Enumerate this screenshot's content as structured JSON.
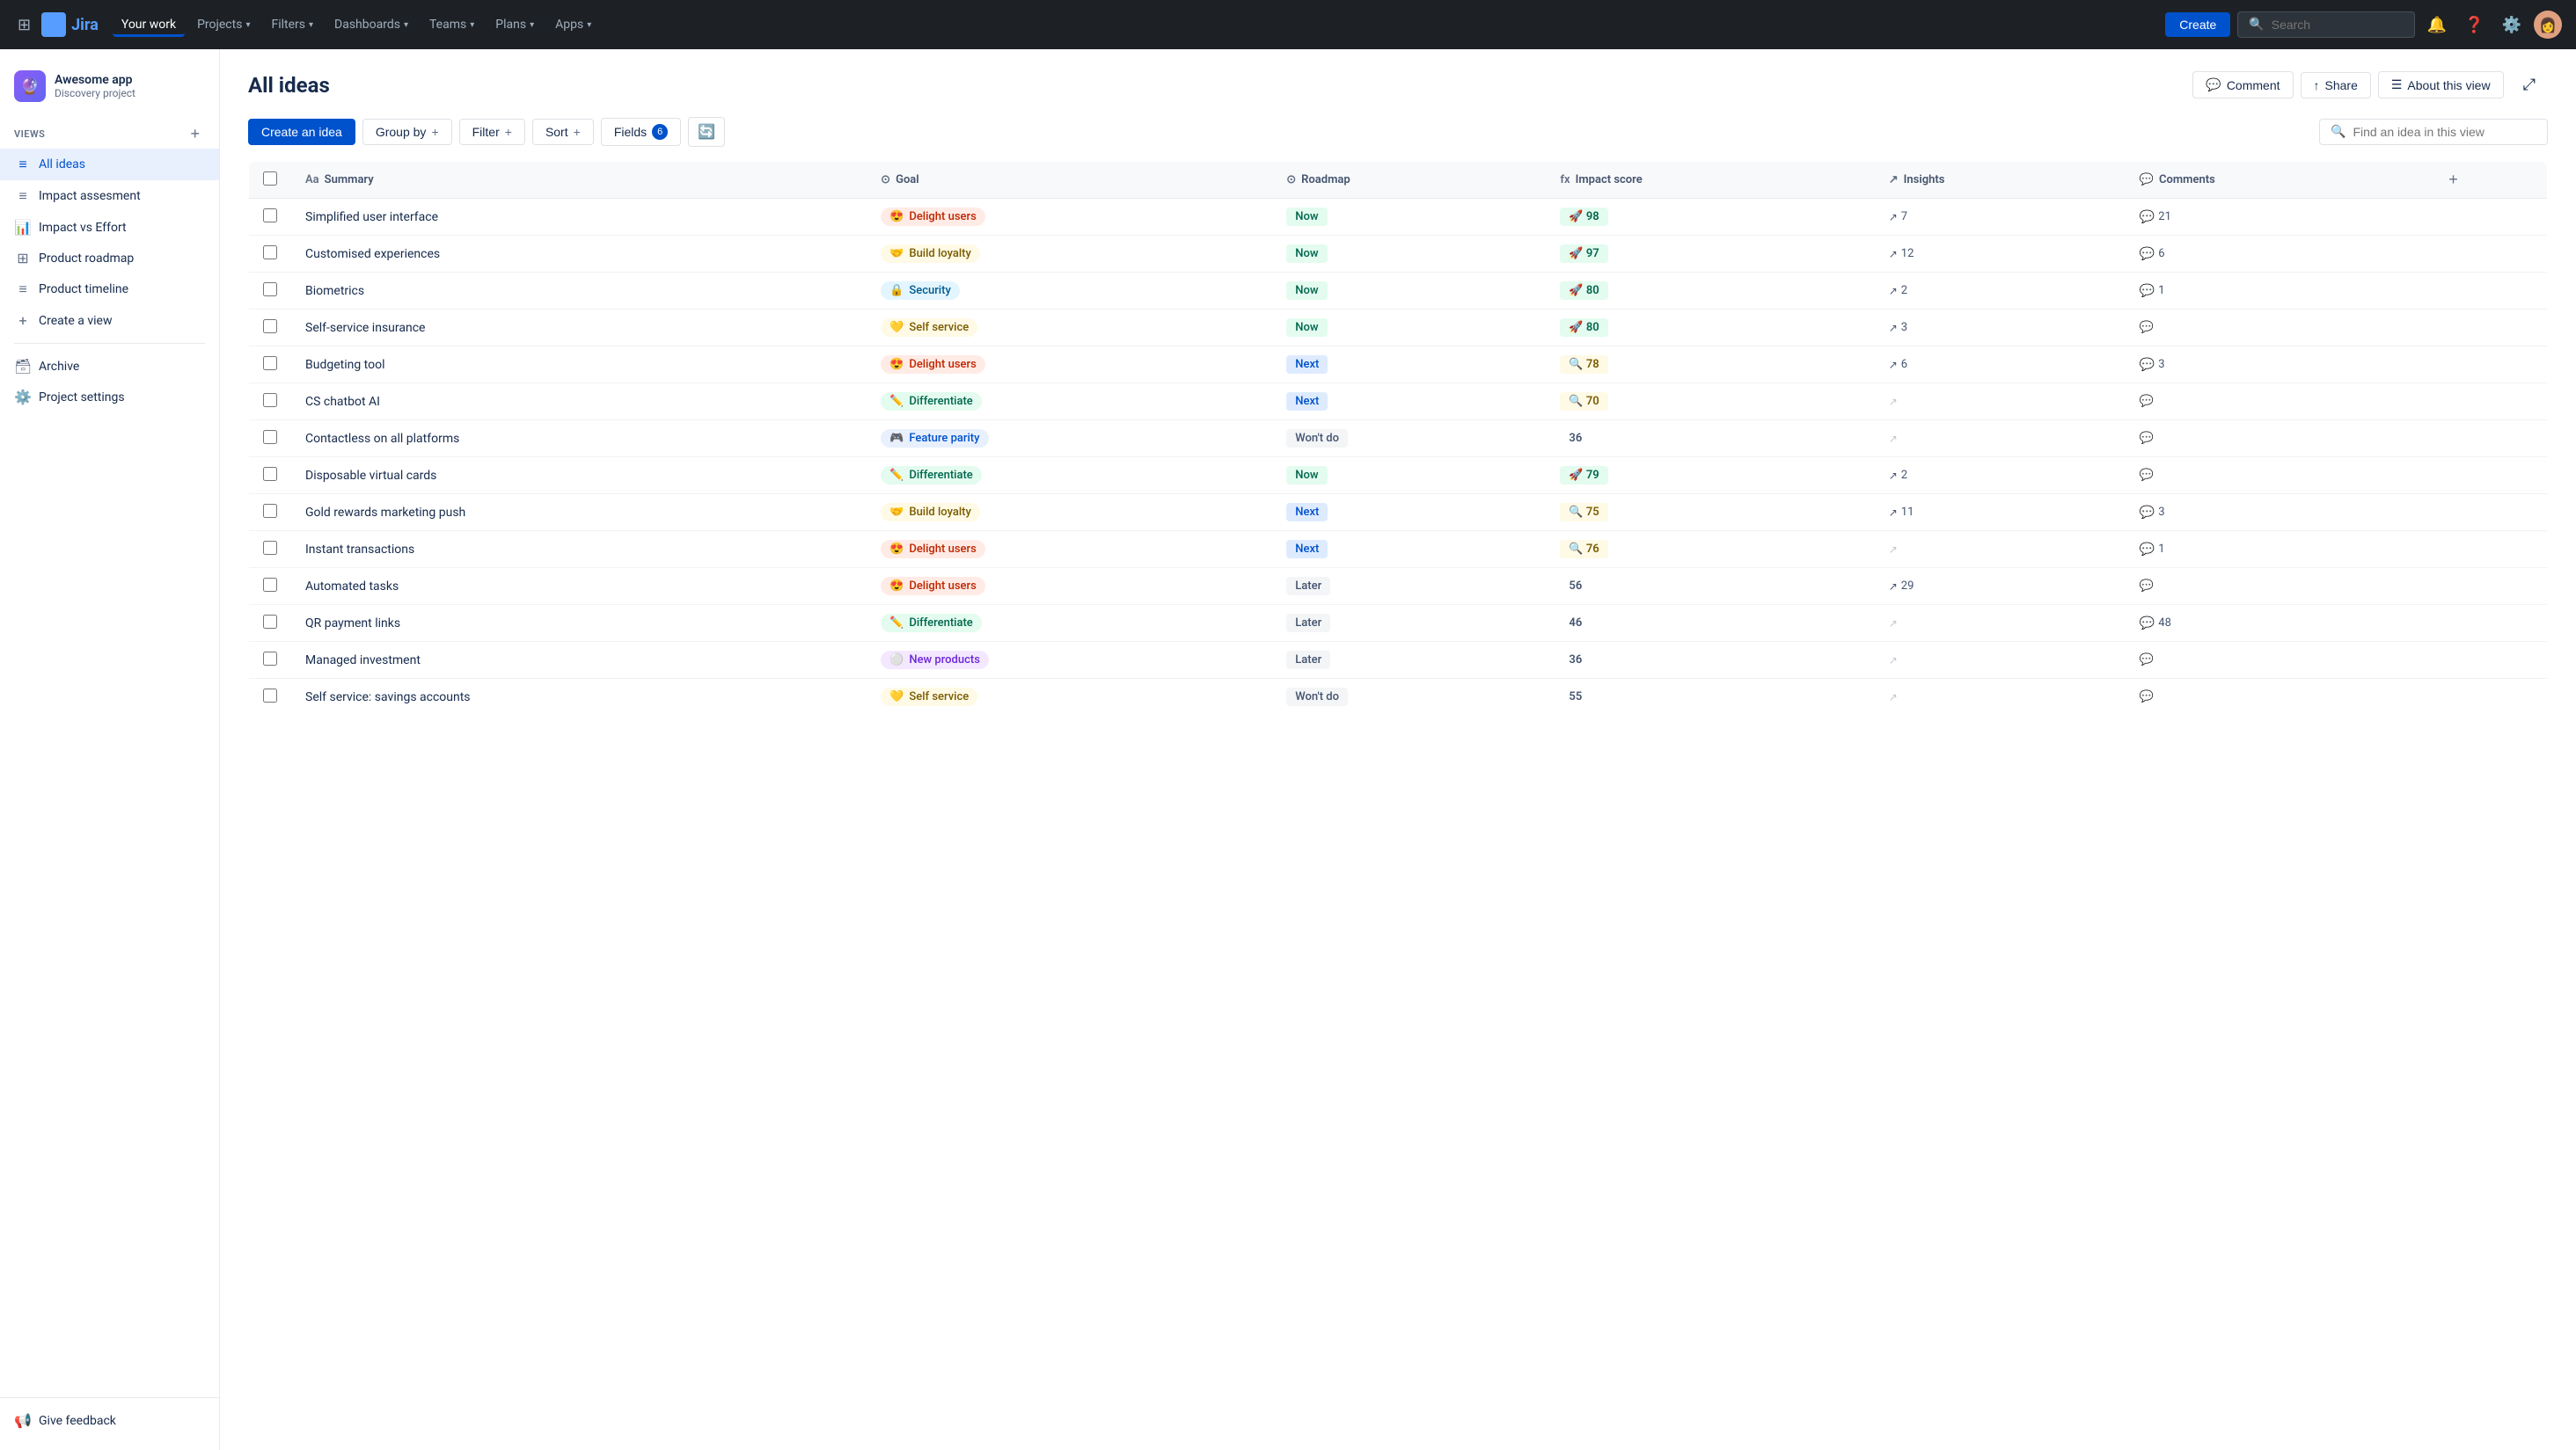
{
  "nav": {
    "logo_text": "Jira",
    "items": [
      {
        "label": "Your work",
        "id": "your-work",
        "active": true
      },
      {
        "label": "Projects",
        "id": "projects"
      },
      {
        "label": "Filters",
        "id": "filters"
      },
      {
        "label": "Dashboards",
        "id": "dashboards"
      },
      {
        "label": "Teams",
        "id": "teams"
      },
      {
        "label": "Plans",
        "id": "plans"
      },
      {
        "label": "Apps",
        "id": "apps"
      }
    ],
    "create_label": "Create",
    "search_placeholder": "Search"
  },
  "sidebar": {
    "project_icon": "🔮",
    "project_name": "Awesome app",
    "project_type": "Discovery project",
    "views_label": "VIEWS",
    "views": [
      {
        "label": "All ideas",
        "id": "all-ideas",
        "icon": "≡",
        "active": true
      },
      {
        "label": "Impact assesment",
        "id": "impact-assesment",
        "icon": "≡"
      },
      {
        "label": "Impact vs Effort",
        "id": "impact-vs-effort",
        "icon": "📊"
      },
      {
        "label": "Product roadmap",
        "id": "product-roadmap",
        "icon": "⊞"
      },
      {
        "label": "Product timeline",
        "id": "product-timeline",
        "icon": "≡"
      },
      {
        "label": "Create a view",
        "id": "create-a-view",
        "icon": "+"
      }
    ],
    "archive_label": "Archive",
    "project_settings_label": "Project settings",
    "feedback_label": "Give feedback"
  },
  "page": {
    "title": "All ideas",
    "comment_btn": "Comment",
    "share_btn": "Share",
    "about_btn": "About this view"
  },
  "toolbar": {
    "create_idea_label": "Create an idea",
    "group_by_label": "Group by",
    "filter_label": "Filter",
    "sort_label": "Sort",
    "fields_label": "Fields",
    "fields_count": "6",
    "search_placeholder": "Find an idea in this view"
  },
  "table": {
    "columns": [
      {
        "label": "Summary",
        "icon": "Aa",
        "id": "summary"
      },
      {
        "label": "Goal",
        "icon": "⊙",
        "id": "goal"
      },
      {
        "label": "Roadmap",
        "icon": "⊙",
        "id": "roadmap"
      },
      {
        "label": "Impact score",
        "icon": "fx",
        "id": "impact"
      },
      {
        "label": "Insights",
        "icon": "↗",
        "id": "insights"
      },
      {
        "label": "Comments",
        "icon": "💬",
        "id": "comments"
      }
    ],
    "rows": [
      {
        "id": 1,
        "summary": "Simplified user interface",
        "goal_emoji": "😍",
        "goal_label": "Delight users",
        "goal_class": "goal-delight",
        "roadmap": "Now",
        "roadmap_class": "roadmap-now",
        "impact_emoji": "🚀",
        "impact_score": "98",
        "impact_class": "impact-high",
        "insights": "7",
        "has_insights": true,
        "comments": "21",
        "has_comments": true
      },
      {
        "id": 2,
        "summary": "Customised experiences",
        "goal_emoji": "🤝",
        "goal_label": "Build loyalty",
        "goal_class": "goal-build",
        "roadmap": "Now",
        "roadmap_class": "roadmap-now",
        "impact_emoji": "🚀",
        "impact_score": "97",
        "impact_class": "impact-high",
        "insights": "12",
        "has_insights": true,
        "comments": "6",
        "has_comments": true
      },
      {
        "id": 3,
        "summary": "Biometrics",
        "goal_emoji": "🔒",
        "goal_label": "Security",
        "goal_class": "goal-security",
        "roadmap": "Now",
        "roadmap_class": "roadmap-now",
        "impact_emoji": "🚀",
        "impact_score": "80",
        "impact_class": "impact-high",
        "insights": "2",
        "has_insights": true,
        "comments": "1",
        "has_comments": true
      },
      {
        "id": 4,
        "summary": "Self-service insurance",
        "goal_emoji": "💛",
        "goal_label": "Self service",
        "goal_class": "goal-self",
        "roadmap": "Now",
        "roadmap_class": "roadmap-now",
        "impact_emoji": "🚀",
        "impact_score": "80",
        "impact_class": "impact-high",
        "insights": "3",
        "has_insights": true,
        "comments": "",
        "has_comments": false
      },
      {
        "id": 5,
        "summary": "Budgeting tool",
        "goal_emoji": "😍",
        "goal_label": "Delight users",
        "goal_class": "goal-delight",
        "roadmap": "Next",
        "roadmap_class": "roadmap-next",
        "impact_emoji": "🔍",
        "impact_score": "78",
        "impact_class": "impact-medium",
        "insights": "6",
        "has_insights": true,
        "comments": "3",
        "has_comments": true
      },
      {
        "id": 6,
        "summary": "CS chatbot AI",
        "goal_emoji": "✏️",
        "goal_label": "Differentiate",
        "goal_class": "goal-differentiate",
        "roadmap": "Next",
        "roadmap_class": "roadmap-next",
        "impact_emoji": "🔍",
        "impact_score": "70",
        "impact_class": "impact-medium",
        "insights": "",
        "has_insights": false,
        "comments": "",
        "has_comments": false
      },
      {
        "id": 7,
        "summary": "Contactless on all platforms",
        "goal_emoji": "🎮",
        "goal_label": "Feature parity",
        "goal_class": "goal-feature",
        "roadmap": "Won't do",
        "roadmap_class": "roadmap-wontdo",
        "impact_emoji": "",
        "impact_score": "36",
        "impact_class": "impact-none",
        "insights": "",
        "has_insights": false,
        "comments": "",
        "has_comments": false
      },
      {
        "id": 8,
        "summary": "Disposable virtual cards",
        "goal_emoji": "✏️",
        "goal_label": "Differentiate",
        "goal_class": "goal-differentiate",
        "roadmap": "Now",
        "roadmap_class": "roadmap-now",
        "impact_emoji": "🚀",
        "impact_score": "79",
        "impact_class": "impact-high",
        "insights": "2",
        "has_insights": true,
        "comments": "",
        "has_comments": false
      },
      {
        "id": 9,
        "summary": "Gold rewards marketing push",
        "goal_emoji": "🤝",
        "goal_label": "Build loyalty",
        "goal_class": "goal-build",
        "roadmap": "Next",
        "roadmap_class": "roadmap-next",
        "impact_emoji": "🔍",
        "impact_score": "75",
        "impact_class": "impact-medium",
        "insights": "11",
        "has_insights": true,
        "comments": "3",
        "has_comments": true
      },
      {
        "id": 10,
        "summary": "Instant transactions",
        "goal_emoji": "😍",
        "goal_label": "Delight users",
        "goal_class": "goal-delight",
        "roadmap": "Next",
        "roadmap_class": "roadmap-next",
        "impact_emoji": "🔍",
        "impact_score": "76",
        "impact_class": "impact-medium",
        "insights": "",
        "has_insights": false,
        "comments": "1",
        "has_comments": true
      },
      {
        "id": 11,
        "summary": "Automated tasks",
        "goal_emoji": "😍",
        "goal_label": "Delight users",
        "goal_class": "goal-delight",
        "roadmap": "Later",
        "roadmap_class": "roadmap-later",
        "impact_emoji": "",
        "impact_score": "56",
        "impact_class": "impact-none",
        "insights": "29",
        "has_insights": true,
        "comments": "",
        "has_comments": false
      },
      {
        "id": 12,
        "summary": "QR payment links",
        "goal_emoji": "✏️",
        "goal_label": "Differentiate",
        "goal_class": "goal-differentiate",
        "roadmap": "Later",
        "roadmap_class": "roadmap-later",
        "impact_emoji": "",
        "impact_score": "46",
        "impact_class": "impact-none",
        "insights": "",
        "has_insights": false,
        "comments": "48",
        "has_comments": true
      },
      {
        "id": 13,
        "summary": "Managed investment",
        "goal_emoji": "⚪",
        "goal_label": "New products",
        "goal_class": "goal-new",
        "roadmap": "Later",
        "roadmap_class": "roadmap-later",
        "impact_emoji": "",
        "impact_score": "36",
        "impact_class": "impact-none",
        "insights": "",
        "has_insights": false,
        "comments": "",
        "has_comments": false
      },
      {
        "id": 14,
        "summary": "Self service: savings accounts",
        "goal_emoji": "💛",
        "goal_label": "Self service",
        "goal_class": "goal-self",
        "roadmap": "Won't do",
        "roadmap_class": "roadmap-wontdo",
        "impact_emoji": "",
        "impact_score": "55",
        "impact_class": "impact-none",
        "insights": "",
        "has_insights": false,
        "comments": "",
        "has_comments": false
      }
    ]
  }
}
